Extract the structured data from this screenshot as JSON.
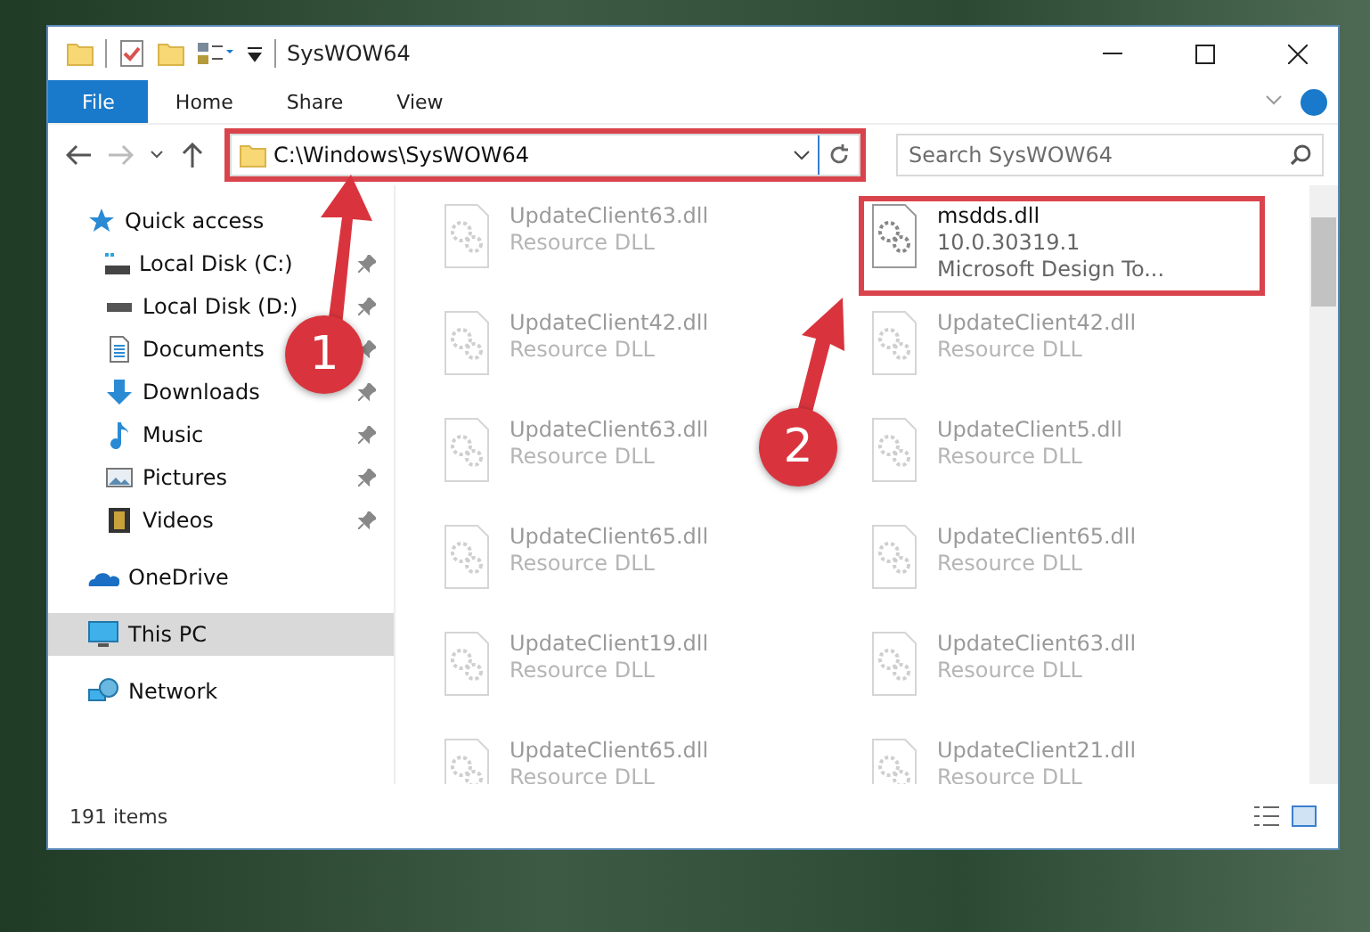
{
  "window": {
    "title": "SysWOW64"
  },
  "ribbon_tabs": [
    {
      "label": "File",
      "selected": true
    },
    {
      "label": "Home",
      "selected": false
    },
    {
      "label": "Share",
      "selected": false
    },
    {
      "label": "View",
      "selected": false
    }
  ],
  "address_bar": {
    "path": "C:\\Windows\\SysWOW64",
    "highlighted": true
  },
  "search": {
    "placeholder": "Search SysWOW64"
  },
  "sidebar": {
    "items": [
      {
        "label": "Quick access",
        "kind": "star",
        "selected": false,
        "children": [
          {
            "label": "Local Disk (C:)",
            "kind": "drive-c",
            "pinned": true,
            "selected": false
          },
          {
            "label": "Local Disk (D:)",
            "kind": "drive",
            "pinned": true,
            "selected": false
          },
          {
            "label": "Documents",
            "kind": "documents",
            "pinned": true,
            "selected": false
          },
          {
            "label": "Downloads",
            "kind": "downloads",
            "pinned": true,
            "selected": false
          },
          {
            "label": "Music",
            "kind": "music",
            "pinned": true,
            "selected": false
          },
          {
            "label": "Pictures",
            "kind": "pictures",
            "pinned": true,
            "selected": false
          },
          {
            "label": "Videos",
            "kind": "videos",
            "pinned": true,
            "selected": false
          }
        ]
      },
      {
        "label": "OneDrive",
        "kind": "cloud",
        "selected": false
      },
      {
        "label": "This PC",
        "kind": "pc",
        "selected": true
      },
      {
        "label": "Network",
        "kind": "network",
        "selected": false
      }
    ]
  },
  "files": [
    {
      "name": "UpdateClient63.dll",
      "details": [
        "Resource DLL"
      ],
      "blurred": true,
      "highlighted": false
    },
    {
      "name": "msdds.dll",
      "details": [
        "10.0.30319.1",
        "Microsoft Design To..."
      ],
      "blurred": false,
      "highlighted": true
    },
    {
      "name": "UpdateClient42.dll",
      "details": [
        "Resource DLL"
      ],
      "blurred": true,
      "highlighted": false
    },
    {
      "name": "UpdateClient42.dll",
      "details": [
        "Resource DLL"
      ],
      "blurred": true,
      "highlighted": false
    },
    {
      "name": "UpdateClient63.dll",
      "details": [
        "Resource DLL"
      ],
      "blurred": true,
      "highlighted": false
    },
    {
      "name": "UpdateClient5.dll",
      "details": [
        "Resource DLL"
      ],
      "blurred": true,
      "highlighted": false
    },
    {
      "name": "UpdateClient65.dll",
      "details": [
        "Resource DLL"
      ],
      "blurred": true,
      "highlighted": false
    },
    {
      "name": "UpdateClient65.dll",
      "details": [
        "Resource DLL"
      ],
      "blurred": true,
      "highlighted": false
    },
    {
      "name": "UpdateClient19.dll",
      "details": [
        "Resource DLL"
      ],
      "blurred": true,
      "highlighted": false
    },
    {
      "name": "UpdateClient63.dll",
      "details": [
        "Resource DLL"
      ],
      "blurred": true,
      "highlighted": false
    },
    {
      "name": "UpdateClient65.dll",
      "details": [
        "Resource DLL"
      ],
      "blurred": true,
      "highlighted": false
    },
    {
      "name": "UpdateClient21.dll",
      "details": [
        "Resource DLL"
      ],
      "blurred": true,
      "highlighted": false
    }
  ],
  "status_bar": {
    "item_count": "191 items"
  },
  "annotations": [
    {
      "number": "1"
    },
    {
      "number": "2"
    }
  ]
}
